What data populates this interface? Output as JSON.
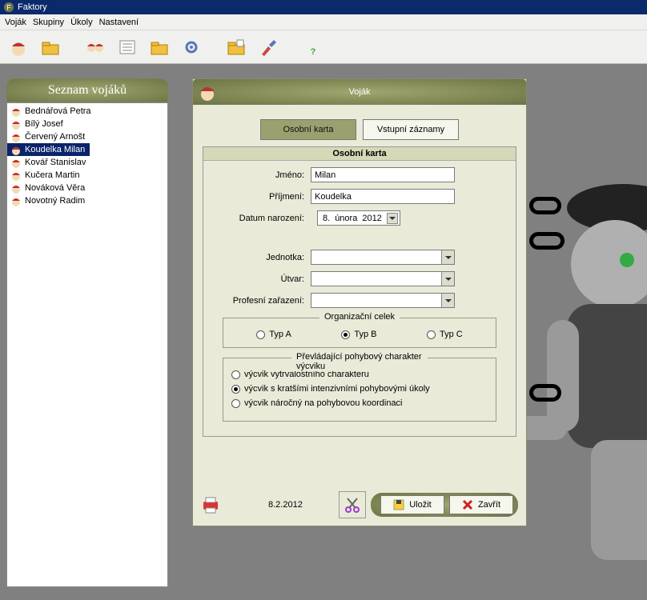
{
  "window": {
    "title": "Faktory"
  },
  "menu": {
    "items": [
      "Voják",
      "Skupiny",
      "Úkoly",
      "Nastavení"
    ]
  },
  "sidebar": {
    "title": "Seznam vojáků",
    "items": [
      {
        "label": "Bednářová Petra"
      },
      {
        "label": "Bílý Josef"
      },
      {
        "label": "Červený Arnošt"
      },
      {
        "label": "Koudelka Milan",
        "selected": true
      },
      {
        "label": "Kovář Stanislav"
      },
      {
        "label": "Kučera Martin"
      },
      {
        "label": "Nováková Věra"
      },
      {
        "label": "Novotný Radim"
      }
    ]
  },
  "dialog": {
    "title": "Voják",
    "tabs": {
      "personal": "Osobní karta",
      "entries": "Vstupní záznamy"
    },
    "section_title": "Osobní karta",
    "labels": {
      "firstname": "Jméno:",
      "lastname": "Příjmení:",
      "birthdate": "Datum narození:",
      "unit": "Jednotka:",
      "formation": "Útvar:",
      "profession": "Profesní zařazení:"
    },
    "values": {
      "firstname": "Milan",
      "lastname": "Koudelka",
      "birth_day": "8.",
      "birth_month": "února",
      "birth_year": "2012",
      "unit": "",
      "formation": "",
      "profession": ""
    },
    "org": {
      "legend": "Organizační celek",
      "a": "Typ A",
      "b": "Typ B",
      "c": "Typ C",
      "selected": "b"
    },
    "training": {
      "legend": "Převládající pohybový charakter výcviku",
      "opt1": "výcvik vytrvalostního charakteru",
      "opt2": "výcvik s kratšími intenzivními pohybovými úkoly",
      "opt3": "výcvik náročný na pohybovou koordinaci",
      "selected": "opt2"
    },
    "footer": {
      "date": "8.2.2012",
      "save": "Uložit",
      "close": "Zavřít"
    }
  }
}
